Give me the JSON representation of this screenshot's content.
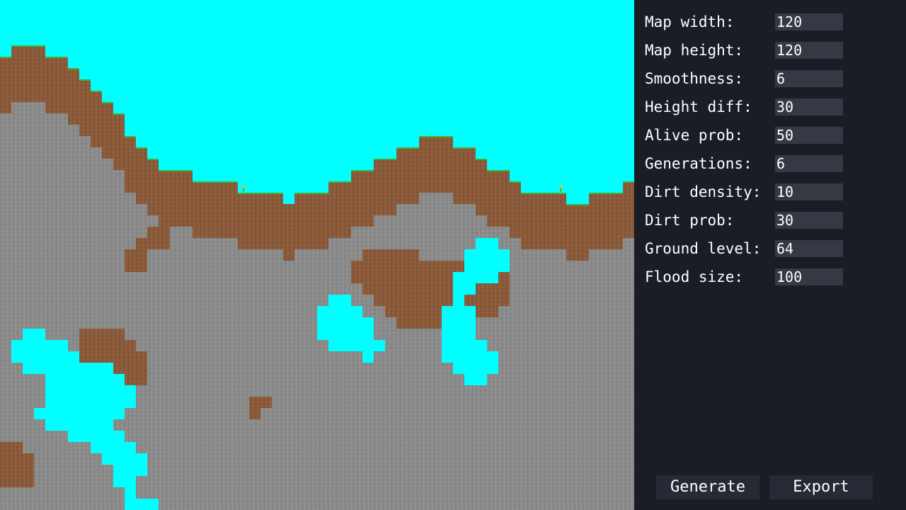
{
  "map": {
    "colors": {
      "sky": "#00ffff",
      "stone": "#8b8b8b",
      "dirt": "#8a5a3a",
      "grass": "#4caf35",
      "flower": "#e0c020"
    }
  },
  "settings": {
    "fields": [
      {
        "key": "map_width",
        "label": "Map width:",
        "value": "120"
      },
      {
        "key": "map_height",
        "label": "Map height:",
        "value": "120"
      },
      {
        "key": "smoothness",
        "label": "Smoothness:",
        "value": "6"
      },
      {
        "key": "height_diff",
        "label": "Height diff:",
        "value": "30"
      },
      {
        "key": "alive_prob",
        "label": "Alive prob:",
        "value": "50"
      },
      {
        "key": "generations",
        "label": "Generations:",
        "value": "6"
      },
      {
        "key": "dirt_density",
        "label": "Dirt density:",
        "value": "10"
      },
      {
        "key": "dirt_prob",
        "label": "Dirt prob:",
        "value": "30"
      },
      {
        "key": "ground_level",
        "label": "Ground level:",
        "value": "64"
      },
      {
        "key": "flood_size",
        "label": "Flood size:",
        "value": "100"
      }
    ]
  },
  "buttons": {
    "generate_label": "Generate",
    "export_label": "Export"
  }
}
